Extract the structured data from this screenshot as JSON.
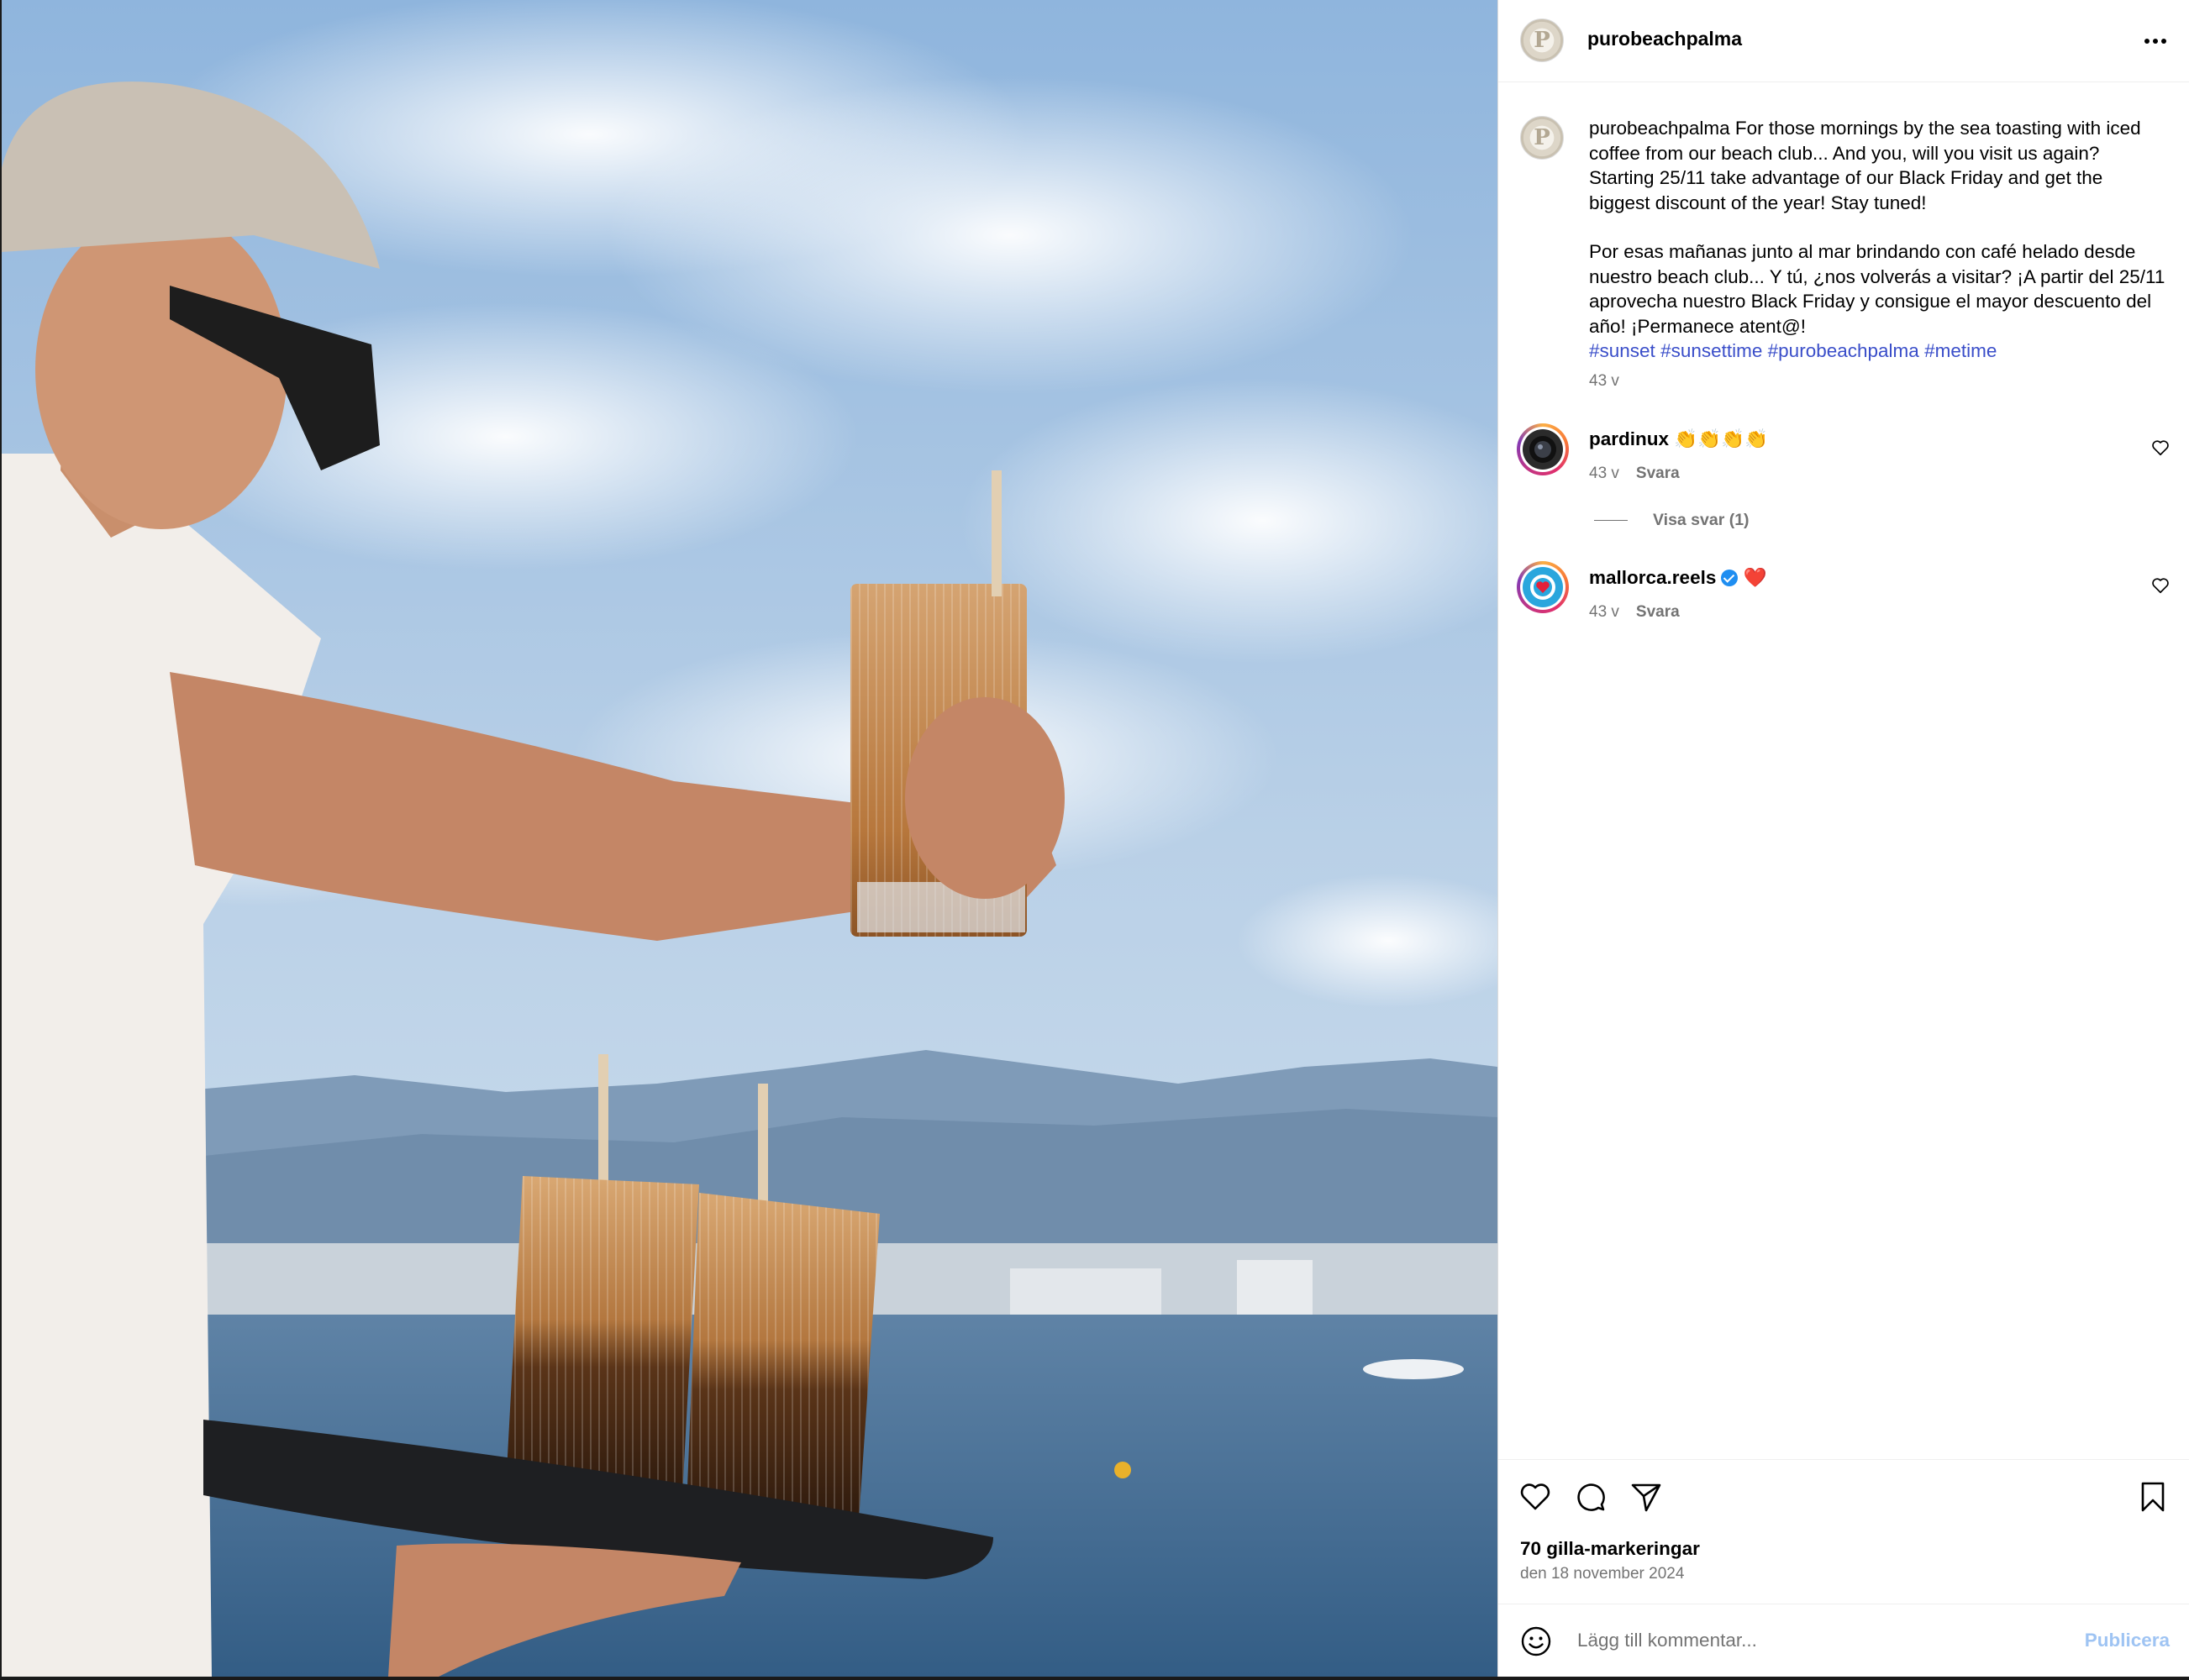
{
  "post": {
    "username": "purobeachpalma",
    "caption_en": "For those mornings by the sea toasting with iced coffee from our beach club... And you, will you visit us again? Starting 25/11 take advantage of our Black Friday and get the biggest discount of the year! Stay tuned!",
    "caption_es": "Por esas mañanas junto al mar brindando con café helado desde nuestro beach club... Y tú, ¿nos volverás a visitar? ¡A partir del 25/11 aprovecha nuestro Black Friday y consigue el mayor descuento del año! ¡Permanece atent@!",
    "hashtags": [
      "#sunset",
      "#sunsettime",
      "#purobeachpalma",
      "#metime"
    ],
    "time": "43 v",
    "likes": "70 gilla-markeringar",
    "date": "den 18 november 2024"
  },
  "comments": [
    {
      "username": "pardinux",
      "text": "👏👏👏👏",
      "time": "43 v",
      "reply": "Svara",
      "view_replies": "Visa svar (1)"
    },
    {
      "username": "mallorca.reels",
      "text": "❤️",
      "time": "43 v",
      "reply": "Svara"
    }
  ],
  "composer": {
    "placeholder": "Lägg till kommentar...",
    "post_label": "Publicera"
  },
  "icons": {
    "avatar_letter": "P",
    "more": "more-options-icon",
    "like": "heart-icon",
    "comment": "comment-icon",
    "share": "share-icon",
    "save": "bookmark-icon",
    "emoji": "emoji-icon"
  },
  "colors": {
    "hashtag": "#3a4ec9",
    "post_button": "#9fc4f3",
    "secondary_text": "#737373",
    "verified": "#1f8ef1"
  }
}
